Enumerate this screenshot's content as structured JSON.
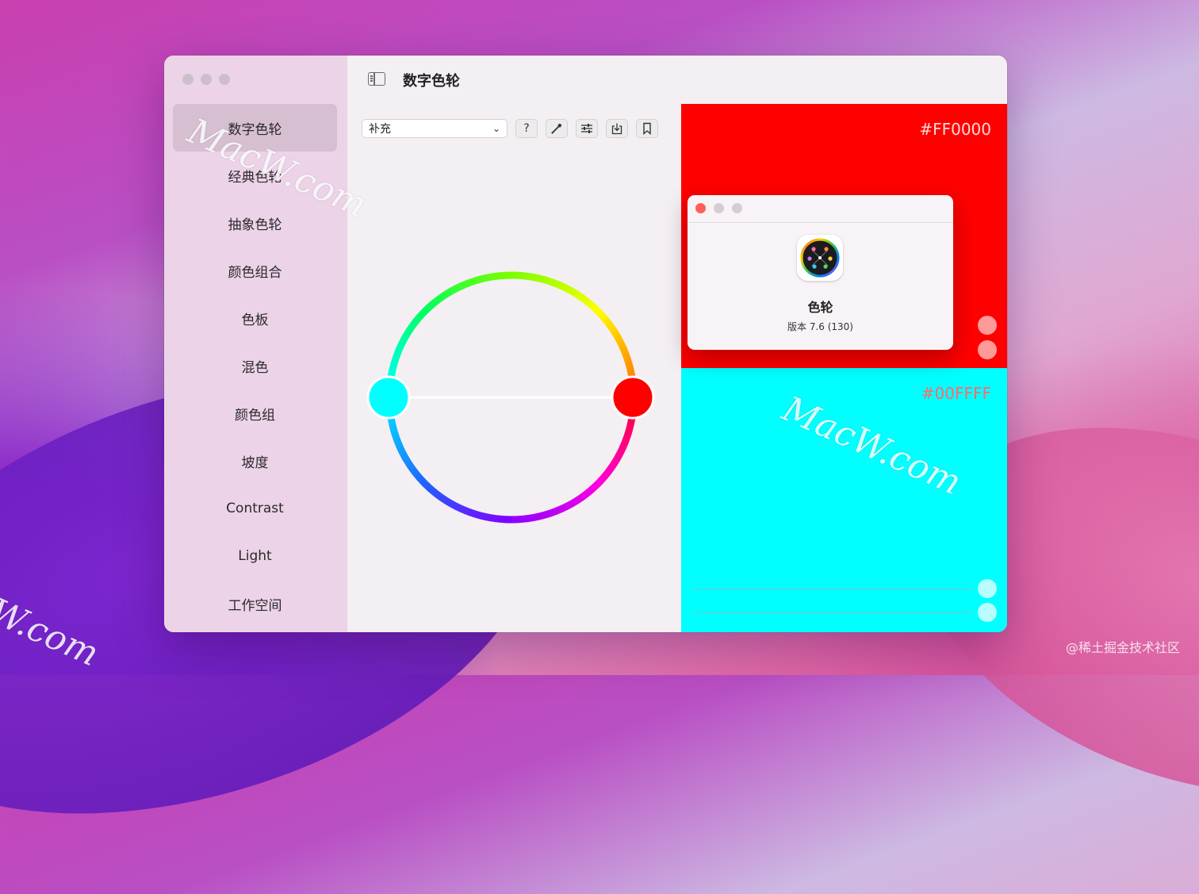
{
  "app": {
    "title": "数字色轮",
    "sidebar_items": [
      "数字色轮",
      "经典色轮",
      "抽象色轮",
      "颜色组合",
      "色板",
      "混色",
      "颜色组",
      "坡度",
      "Contrast",
      "Light",
      "工作空间"
    ],
    "active_index": 0
  },
  "toolbar": {
    "mode_value": "补充",
    "help_label": "?",
    "icons": [
      "eyedropper-icon",
      "sliders-icon",
      "export-icon",
      "bookmark-icon"
    ]
  },
  "wheel": {
    "colors": {
      "left_handle": "#00ffff",
      "right_handle": "#ff0000"
    }
  },
  "swatches": [
    {
      "hex": "#FF0000",
      "color": "#ff0000"
    },
    {
      "hex": "#00FFFF",
      "color": "#00ffff"
    }
  ],
  "about": {
    "app_name": "色轮",
    "version": "版本 7.6 (130)"
  },
  "watermarks": [
    "MacW.com",
    "MacW.com",
    "W.com"
  ],
  "credit": "@稀土掘金技术社区"
}
